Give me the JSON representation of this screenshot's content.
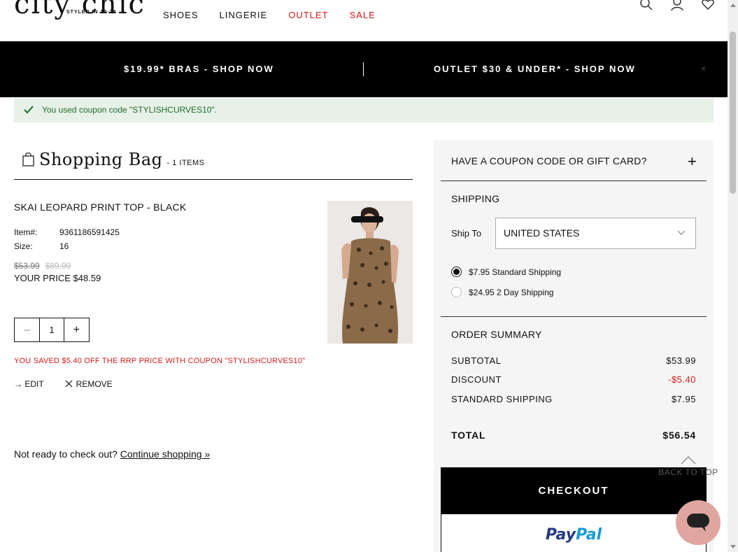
{
  "header": {
    "logo": "city chic",
    "logo_sub": "STYLED IN 12-24",
    "nav": [
      "SHOES",
      "LINGERIE",
      "OUTLET",
      "SALE"
    ]
  },
  "promo": {
    "left": "$19.99* BRAS - SHOP NOW",
    "right": "OUTLET $30 & UNDER* - SHOP NOW",
    "close": "×"
  },
  "coupon_message": "You used coupon code \"STYLISHCURVES10\".",
  "bag": {
    "title": "Shopping Bag",
    "count": "- 1 ITEMS"
  },
  "item": {
    "name": "SKAI LEOPARD PRINT TOP - BLACK",
    "item_label": "Item#:",
    "item_number": "9361186591425",
    "size_label": "Size:",
    "size": "16",
    "price_was": "$53.99",
    "price_rrp": "$89.99",
    "your_price": "YOUR PRICE $48.59",
    "quantity": "1",
    "saved": "YOU SAVED $5.40 OFF THE RRP PRICE WITH COUPON \"STYLISHCURVES10\"",
    "edit": "→ EDIT",
    "remove": "REMOVE"
  },
  "not_ready": {
    "text": "Not ready to check out?",
    "link": "Continue shopping »"
  },
  "sidebar": {
    "coupon_title": "HAVE A COUPON CODE OR GIFT CARD?",
    "shipping_title": "SHIPPING",
    "ship_to_label": "Ship To",
    "ship_to_value": "UNITED STATES",
    "option_standard": "$7.95 Standard Shipping",
    "option_2day": "$24.95 2 Day Shipping",
    "order_summary_title": "ORDER SUMMARY",
    "subtotal_label": "SUBTOTAL",
    "subtotal_value": "$53.99",
    "discount_label": "DISCOUNT",
    "discount_value": "-$5.40",
    "shipping_label": "STANDARD SHIPPING",
    "shipping_value": "$7.95",
    "total_label": "TOTAL",
    "total_value": "$56.54"
  },
  "checkout_label": "CHECKOUT",
  "paypal": {
    "pay": "Pay",
    "pal": "Pal"
  },
  "back_to_top": "BACK TO TOP",
  "colors": {
    "accent_red": "#d51a1a",
    "success_bg": "#e7f1e7",
    "chat": "#dfa69f"
  }
}
